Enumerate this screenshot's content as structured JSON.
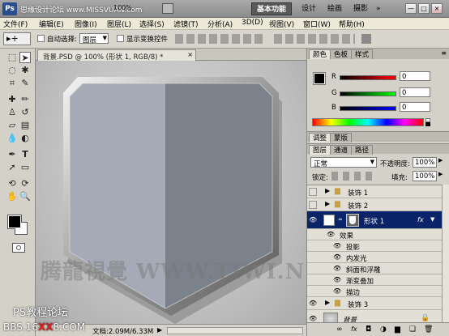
{
  "app": {
    "logo": "Ps",
    "watermark_top": "思缘设计论坛  www.MISSVUAN.com",
    "zoom_display": "100%",
    "workspaces": [
      "基本功能",
      "设计",
      "绘画",
      "摄影"
    ],
    "win_buttons": [
      "—",
      "□",
      "×"
    ]
  },
  "menu": [
    "文件(F)",
    "编辑(E)",
    "图像(I)",
    "图层(L)",
    "选择(S)",
    "滤镜(T)",
    "分析(A)",
    "3D(D)",
    "视图(V)",
    "窗口(W)",
    "帮助(H)"
  ],
  "options": {
    "auto_select_label": "自动选择:",
    "auto_select_value": "图层",
    "show_transform_label": "显示变换控件"
  },
  "document": {
    "tab_label": "背景.PSD @ 100% (形状 1, RGB/8) *",
    "close": "×",
    "watermark_center": "腾龍視覺 WWW.TIWI.NET",
    "watermark_bottom_1": "PS教程论坛",
    "watermark_bottom_2": "BBS.16",
    "watermark_bottom_xx": "XX",
    "watermark_bottom_3": "8.COM",
    "status": "文档:2.09M/6.33M"
  },
  "color_panel": {
    "tabs": [
      "颜色",
      "色板",
      "样式"
    ],
    "channels": [
      {
        "label": "R",
        "value": "0",
        "color": "#d21010"
      },
      {
        "label": "G",
        "value": "0",
        "color": "#10a010"
      },
      {
        "label": "B",
        "value": "0",
        "color": "#1030d0"
      }
    ]
  },
  "adjust_panel": {
    "tabs": [
      "调整",
      "蒙版"
    ]
  },
  "layers_panel": {
    "tabs": [
      "图层",
      "通道",
      "路径"
    ],
    "blend_mode": "正常",
    "opacity_label": "不透明度:",
    "opacity_value": "100%",
    "lock_label": "锁定:",
    "fill_label": "填充:",
    "fill_value": "100%",
    "layers": [
      {
        "name": "装饰 1",
        "type": "group"
      },
      {
        "name": "装饰 2",
        "type": "group"
      },
      {
        "name": "形状 1",
        "type": "shape",
        "selected": true
      },
      {
        "name": "效果",
        "type": "effects-header"
      },
      {
        "name": "投影",
        "type": "effect"
      },
      {
        "name": "内发光",
        "type": "effect"
      },
      {
        "name": "斜面和浮雕",
        "type": "effect"
      },
      {
        "name": "渐变叠加",
        "type": "effect"
      },
      {
        "name": "描边",
        "type": "effect"
      },
      {
        "name": "装饰 3",
        "type": "group"
      },
      {
        "name": "背景",
        "type": "background"
      }
    ],
    "fx_badge": "fx"
  }
}
